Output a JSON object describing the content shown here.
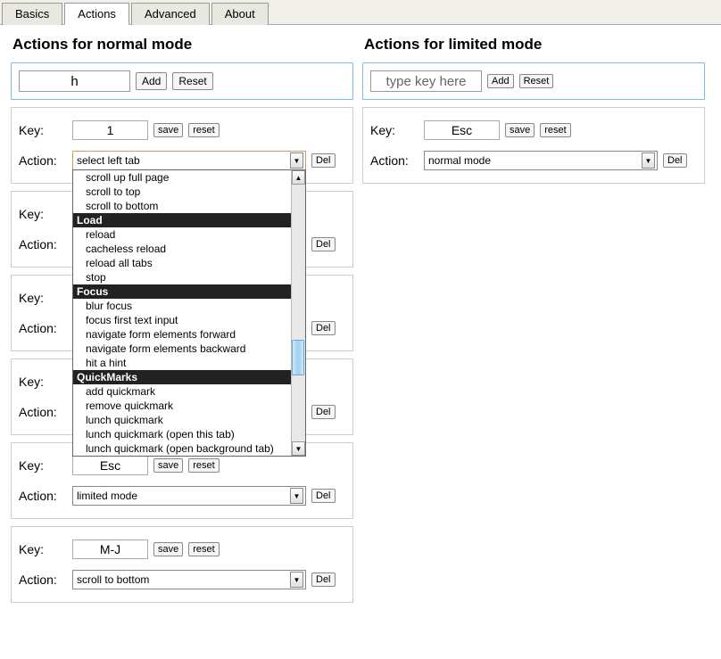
{
  "tabs": {
    "items": [
      "Basics",
      "Actions",
      "Advanced",
      "About"
    ],
    "active_index": 1
  },
  "normal_section": {
    "title": "Actions for normal mode",
    "key_input_value": "h",
    "add_label": "Add",
    "reset_label": "Reset"
  },
  "limited_section": {
    "title": "Actions for limited mode",
    "key_input_placeholder": "type key here",
    "add_label": "Add",
    "reset_label": "Reset"
  },
  "labels": {
    "key": "Key:",
    "action": "Action:",
    "save": "save",
    "reset": "reset",
    "del": "Del"
  },
  "normal_actions": [
    {
      "key": "1",
      "action": "select left tab",
      "dropdown_open": true
    },
    {
      "key": "",
      "action": ""
    },
    {
      "key": "",
      "action": ""
    },
    {
      "key": "",
      "action": ""
    },
    {
      "key": "Esc",
      "action": "limited mode"
    },
    {
      "key": "M-J",
      "action": "scroll to bottom"
    }
  ],
  "limited_actions": [
    {
      "key": "Esc",
      "action": "normal mode"
    }
  ],
  "dropdown": {
    "items": [
      {
        "type": "item",
        "text": "scroll up full page"
      },
      {
        "type": "item",
        "text": "scroll to top"
      },
      {
        "type": "item",
        "text": "scroll to bottom"
      },
      {
        "type": "group",
        "text": "Load"
      },
      {
        "type": "item",
        "text": "reload"
      },
      {
        "type": "item",
        "text": "cacheless reload"
      },
      {
        "type": "item",
        "text": "reload all tabs"
      },
      {
        "type": "item",
        "text": "stop"
      },
      {
        "type": "group",
        "text": "Focus"
      },
      {
        "type": "item",
        "text": "blur focus"
      },
      {
        "type": "item",
        "text": "focus first text input"
      },
      {
        "type": "item",
        "text": "navigate form elements forward"
      },
      {
        "type": "item",
        "text": "navigate form elements backward"
      },
      {
        "type": "item",
        "text": "hit a hint"
      },
      {
        "type": "group",
        "text": "QuickMarks"
      },
      {
        "type": "item",
        "text": "add quickmark"
      },
      {
        "type": "item",
        "text": "remove quickmark"
      },
      {
        "type": "item",
        "text": "lunch quickmark"
      },
      {
        "type": "item",
        "text": "lunch quickmark (open this tab)"
      },
      {
        "type": "item",
        "text": "lunch quickmark (open background tab)"
      }
    ]
  }
}
